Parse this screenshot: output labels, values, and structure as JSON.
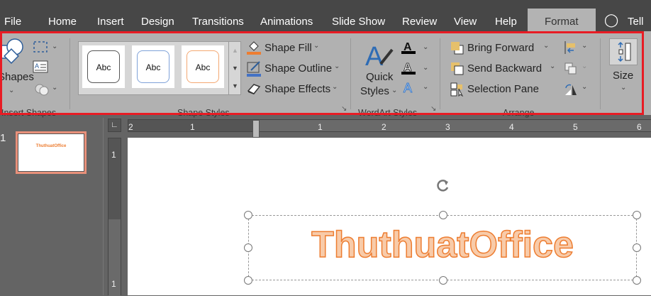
{
  "tabs": [
    "File",
    "Home",
    "Insert",
    "Design",
    "Transitions",
    "Animations",
    "Slide Show",
    "Review",
    "View",
    "Help",
    "Format"
  ],
  "active_tab": "Format",
  "tell_me": "Tell m",
  "ribbon": {
    "insert_shapes": {
      "shapes_label": "Shapes",
      "group_label": "Insert Shapes"
    },
    "shape_styles": {
      "presets": [
        "Abc",
        "Abc",
        "Abc"
      ],
      "fill": "Shape Fill",
      "outline": "Shape Outline",
      "effects": "Shape Effects",
      "group_label": "Shape Styles"
    },
    "wordart": {
      "quick": "Quick",
      "styles": "Styles",
      "group_label": "WordArt Styles"
    },
    "arrange": {
      "bring_forward": "Bring Forward",
      "send_backward": "Send Backward",
      "selection_pane": "Selection Pane",
      "group_label": "Arrange"
    },
    "size": {
      "label": "Size"
    }
  },
  "slide_panel": {
    "number": "1",
    "thumb_text": "ThuthuatOffice"
  },
  "ruler": {
    "h_labels": [
      "2",
      "1",
      "1",
      "2",
      "3",
      "4",
      "5",
      "6"
    ],
    "v_labels": [
      "1",
      "1"
    ]
  },
  "slide": {
    "text": "ThuthuatOffice"
  },
  "colors": {
    "accent": "#ed7d31",
    "highlight": "#e81c24"
  }
}
